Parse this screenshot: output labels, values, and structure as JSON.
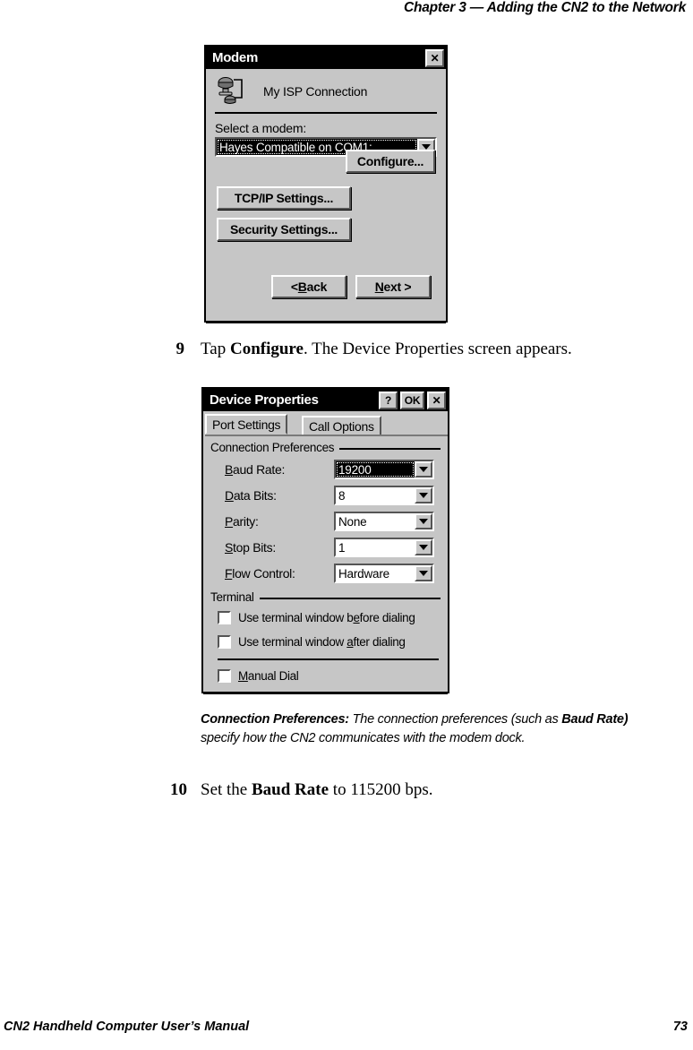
{
  "page": {
    "running_head": "Chapter 3 — Adding the CN2 to the Network",
    "footer_title": "CN2 Handheld Computer User’s Manual",
    "footer_page": "73"
  },
  "modem_dialog": {
    "title": "Modem",
    "close_label": "✕",
    "connection_name": "My ISP Connection",
    "connection_icon": "modem-connection-icon",
    "select_label": "Select a modem:",
    "modem_combo": {
      "value": "Hayes Compatible on COM1:",
      "selected": true,
      "arrow_icon": "chevron-down-icon"
    },
    "buttons": {
      "configure": "Configure...",
      "tcpip": "TCP/IP Settings...",
      "security": "Security Settings...",
      "back": "< Back",
      "back_prefix": "< ",
      "back_accel": "B",
      "back_rest": "ack",
      "next_prefix": "",
      "next_accel": "N",
      "next_rest": "ext >"
    }
  },
  "step9": {
    "number": "9",
    "text_pre": "Tap ",
    "text_bold": "Configure",
    "text_post": ". The Device Properties screen appears."
  },
  "device_dialog": {
    "title": "Device Properties",
    "titlebar_buttons": {
      "help": "?",
      "ok": "OK",
      "close": "✕"
    },
    "tabs": [
      {
        "label": "Port Settings",
        "active": true
      },
      {
        "label": "Call Options",
        "active": false
      }
    ],
    "group_connection": {
      "title": "Connection Preferences",
      "rows": [
        {
          "label_accel": "B",
          "label_pre": "",
          "label_post": "aud Rate:",
          "value": "19200",
          "selected": true
        },
        {
          "label_accel": "D",
          "label_pre": "",
          "label_post": "ata Bits:",
          "value": "8",
          "selected": false
        },
        {
          "label_accel": "P",
          "label_pre": "",
          "label_post": "arity:",
          "value": "None",
          "selected": false
        },
        {
          "label_accel": "S",
          "label_pre": "",
          "label_post": "top Bits:",
          "value": "1",
          "selected": false
        },
        {
          "label_accel": "F",
          "label_pre": "",
          "label_post": "low Control:",
          "value": "Hardware",
          "selected": false
        }
      ]
    },
    "group_terminal": {
      "title": "Terminal",
      "checkboxes": [
        {
          "pre": "Use terminal window b",
          "accel": "e",
          "post": "fore dialing",
          "checked": false
        },
        {
          "pre": "Use terminal window ",
          "accel": "a",
          "post": "fter dialing",
          "checked": false
        }
      ],
      "manual_dial": {
        "pre": "",
        "accel": "M",
        "post": "anual Dial",
        "checked": false
      }
    }
  },
  "caption": {
    "bold_lead": "Connection Preferences:",
    "text_1": " The connection preferences (such as ",
    "bold_2": "Baud Rate)",
    "text_2": " specify how the CN2 communicates with the modem dock."
  },
  "step10": {
    "number": "10",
    "text_pre": "Set the ",
    "text_bold": "Baud Rate",
    "text_post": " to 115200 bps."
  }
}
